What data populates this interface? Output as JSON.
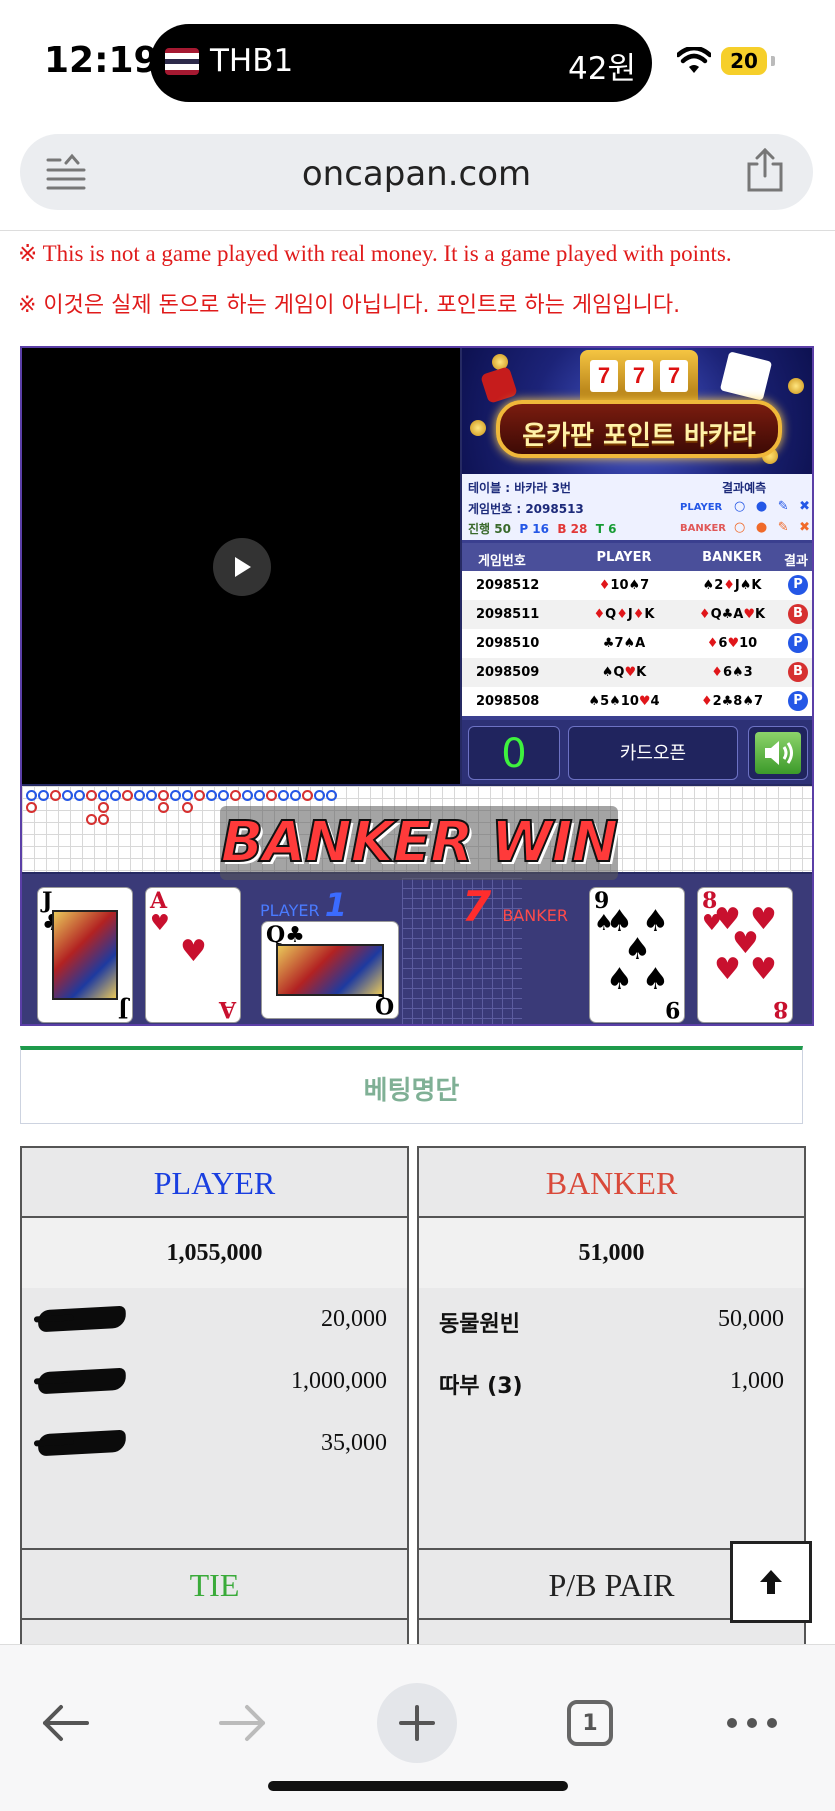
{
  "status_bar": {
    "time": "12:19",
    "island_left": "THB1",
    "island_right": "42원",
    "battery": "20"
  },
  "url_bar": {
    "url": "oncapan.com"
  },
  "notice": {
    "en": "※ This is not a game played with real money. It is a game played with points.",
    "kr": "※ 이것은 실제 돈으로 하는 게임이 아닙니다. 포인트로 하는 게임입니다."
  },
  "game": {
    "banner_title": "온카판 포인트 바카라",
    "slot_reels": [
      "7",
      "7",
      "7"
    ],
    "table_label": "테이블 : 바카라 3번",
    "game_no_label": "게임번호 : 2098513",
    "progress_label": "진행 50",
    "p_count": "P 16",
    "b_count": "B 28",
    "t_count": "T 6",
    "prediction_title": "결과예측",
    "pred_player_label": "PLAYER",
    "pred_banker_label": "BANKER",
    "pred_player_symbols": "○ ● ✎ ✖",
    "pred_banker_symbols": "○ ● ✎ ✖",
    "results": {
      "headers": [
        "게임번호",
        "PLAYER",
        "BANKER",
        "결과"
      ],
      "rows": [
        {
          "no": "2098512",
          "player": "♦10♠7",
          "banker": "♠2♦J♠K",
          "result": "P"
        },
        {
          "no": "2098511",
          "player": "♦Q♦J♦K",
          "banker": "♦Q♣A♥K",
          "result": "B"
        },
        {
          "no": "2098510",
          "player": "♣7♠A",
          "banker": "♦6♥10",
          "result": "P"
        },
        {
          "no": "2098509",
          "player": "♠Q♥K",
          "banker": "♦6♠3",
          "result": "B"
        },
        {
          "no": "2098508",
          "player": "♠5♠10♥4",
          "banker": "♦2♣8♠7",
          "result": "P"
        }
      ]
    },
    "counter": "0",
    "card_open_label": "카드오픈",
    "win_text": "BANKER WIN",
    "player_label": "PLAYER",
    "player_score": "1",
    "banker_label": "BANKER",
    "banker_score": "7",
    "player_cards": [
      {
        "rank": "J",
        "suit": "♣",
        "color": "#000000",
        "face": true
      },
      {
        "rank": "A",
        "suit": "♥",
        "color": "#c8102e",
        "face": false
      },
      {
        "rank": "Q",
        "suit": "♣",
        "color": "#000000",
        "face": true
      }
    ],
    "banker_cards": [
      {
        "rank": "9",
        "suit": "♠",
        "color": "#000000",
        "face": false
      },
      {
        "rank": "8",
        "suit": "♥",
        "color": "#c8102e",
        "face": false
      }
    ]
  },
  "betting": {
    "tab_label": "베팅명단",
    "player": {
      "title": "PLAYER",
      "title_color": "#1a3fe0",
      "total": "1,055,000",
      "rows": [
        {
          "name": "",
          "amount": "20,000",
          "redacted": true
        },
        {
          "name": "",
          "amount": "1,000,000",
          "redacted": true
        },
        {
          "name": "",
          "amount": "35,000",
          "redacted": true
        }
      ]
    },
    "banker": {
      "title": "BANKER",
      "title_color": "#d9493a",
      "total": "51,000",
      "rows": [
        {
          "name": "동물원빈",
          "amount": "50,000"
        },
        {
          "name": "따부 (3)",
          "amount": "1,000"
        }
      ]
    },
    "tie": {
      "title": "TIE",
      "title_color": "#3aab3a"
    },
    "pair": {
      "title": "P/B PAIR",
      "title_color": "#222222"
    }
  },
  "toolbar": {
    "tab_count": "1"
  }
}
